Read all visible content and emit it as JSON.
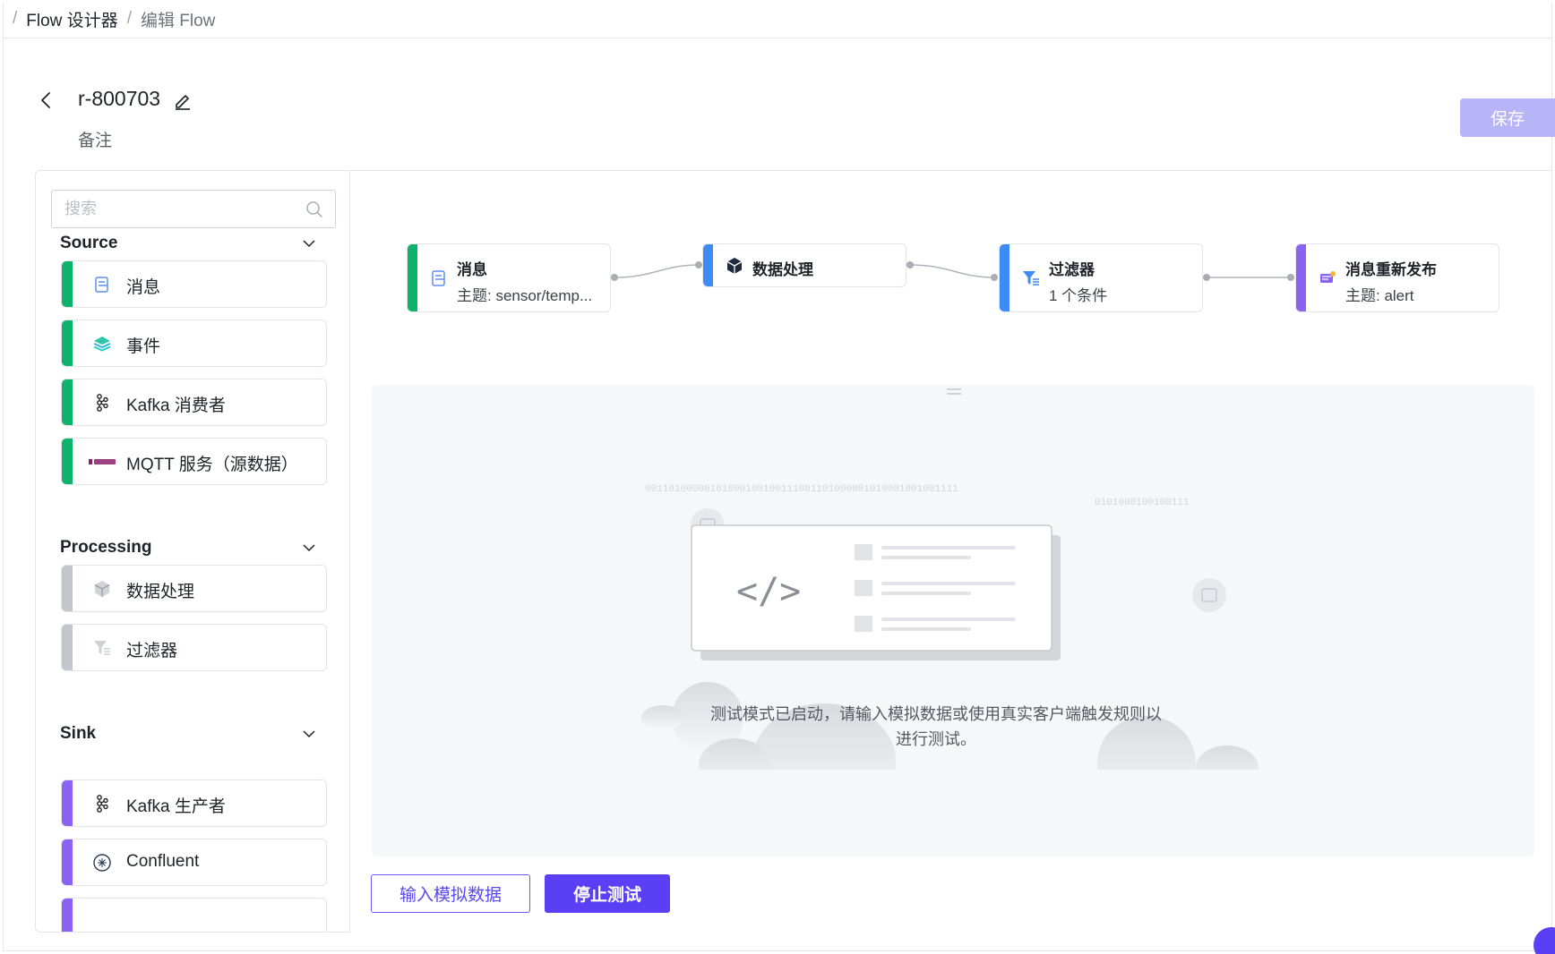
{
  "breadcrumb": {
    "items": [
      "Flow 设计器",
      "编辑 Flow"
    ]
  },
  "header": {
    "title": "r-800703",
    "note": "备注",
    "save_label": "保存"
  },
  "sidebar": {
    "search_placeholder": "搜索",
    "groups": [
      {
        "title": "Source",
        "items": [
          {
            "label": "消息",
            "icon": "message-icon"
          },
          {
            "label": "事件",
            "icon": "layers-icon"
          },
          {
            "label": "Kafka 消费者",
            "icon": "kafka-icon"
          },
          {
            "label": "MQTT 服务（源数据）",
            "icon": "mqtt-logo"
          }
        ]
      },
      {
        "title": "Processing",
        "items": [
          {
            "label": "数据处理",
            "icon": "cube-icon"
          },
          {
            "label": "过滤器",
            "icon": "filter-icon"
          }
        ]
      },
      {
        "title": "Sink",
        "items": [
          {
            "label": "Kafka 生产者",
            "icon": "kafka-icon"
          },
          {
            "label": "Confluent",
            "icon": "confluent-icon"
          }
        ]
      }
    ]
  },
  "flow": {
    "nodes": [
      {
        "title": "消息",
        "sub": "主题: sensor/temp...",
        "color": "#0db36b"
      },
      {
        "title": "数据处理",
        "sub": "",
        "color": "#3d8cf5"
      },
      {
        "title": "过滤器",
        "sub": "1 个条件",
        "color": "#3d8cf5"
      },
      {
        "title": "消息重新发布",
        "sub": "主题: alert",
        "color": "#8a63f3"
      }
    ]
  },
  "test": {
    "message": "测试模式已启动，请输入模拟数据或使用真实客户端触发规则以进行测试。",
    "mock_label": "输入模拟数据",
    "stop_label": "停止测试",
    "binary_a": "00110100000101000100100111001101000001010001001001111",
    "binary_b": "0101000100100111"
  },
  "colors": {
    "accent": "#5a3ff5",
    "source": "#0db36b",
    "processing": "#c2c6cd",
    "sink": "#8a63f3"
  }
}
